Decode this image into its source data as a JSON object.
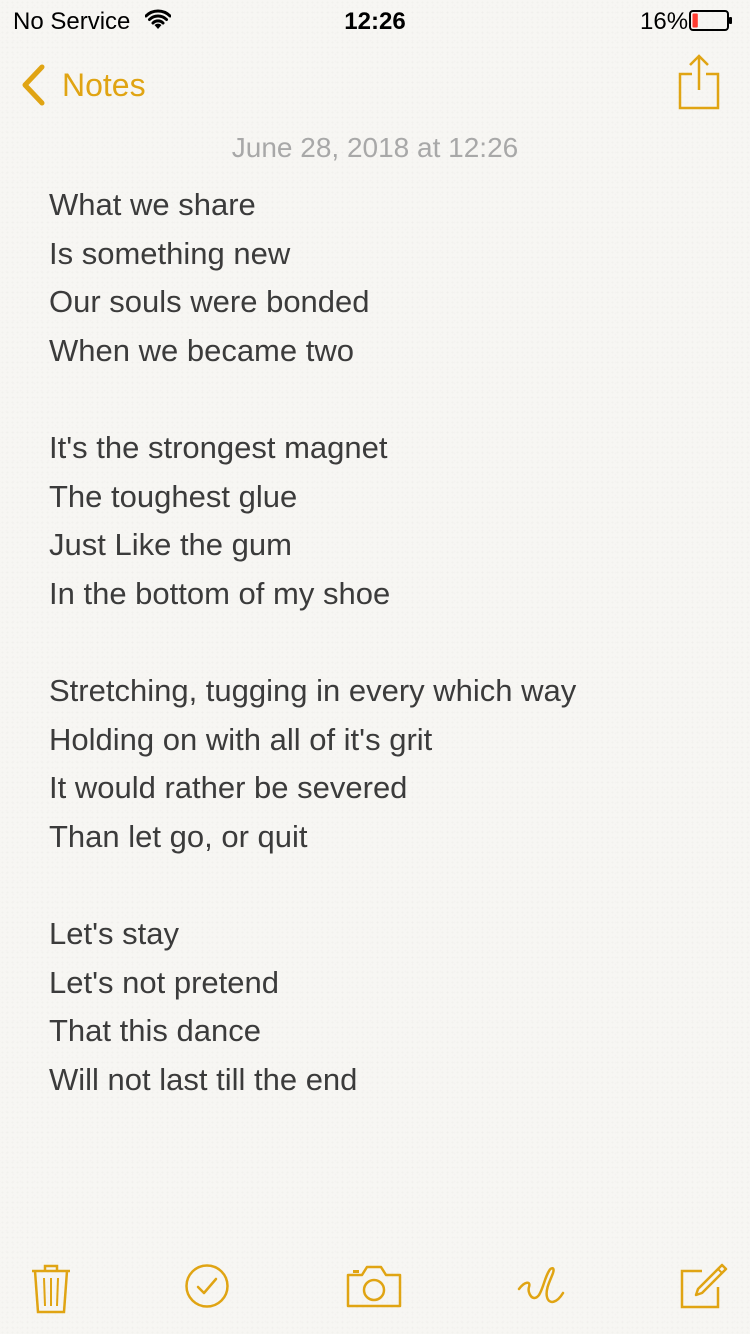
{
  "status_bar": {
    "carrier": "No Service",
    "time": "12:26",
    "battery_percent": "16%",
    "battery_level": 0.16,
    "battery_color": "#ff3b30"
  },
  "nav": {
    "back_label": "Notes",
    "accent_color": "#e0a413"
  },
  "note": {
    "date": "June 28, 2018 at 12:26",
    "stanzas": [
      [
        "What we share",
        "Is something new",
        "Our souls were bonded",
        "When we became two"
      ],
      [
        "It's the strongest magnet",
        "The toughest glue",
        "Just Like the gum",
        "In the bottom of my shoe"
      ],
      [
        "Stretching, tugging in every which way",
        "Holding on with all of it's grit",
        "It would rather be severed",
        "Than let go, or quit"
      ],
      [
        "Let's stay",
        "Let's not pretend",
        "That this dance",
        "Will not last till the end"
      ]
    ]
  },
  "toolbar": {
    "icons": [
      "trash-icon",
      "checklist-icon",
      "camera-icon",
      "sketch-icon",
      "compose-icon"
    ]
  }
}
